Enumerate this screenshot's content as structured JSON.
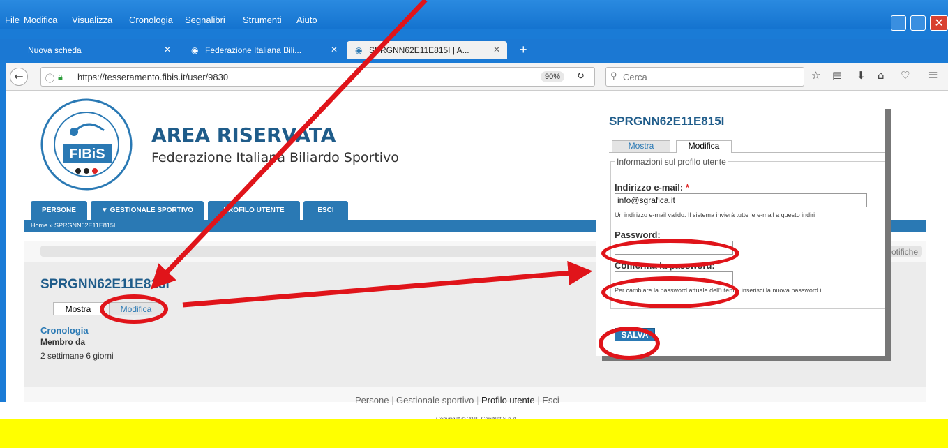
{
  "browser": {
    "menu": [
      "File",
      "Modifica",
      "Visualizza",
      "Cronologia",
      "Segnalibri",
      "Strumenti",
      "Aiuto"
    ],
    "tabs": [
      {
        "label": "Nuova scheda"
      },
      {
        "label": "Federazione Italiana Bili..."
      },
      {
        "label": "SPRGNN62E11E815I | A..."
      }
    ],
    "url": "https://tesseramento.fibis.it/user/9830",
    "zoom": "90%",
    "search_placeholder": "Cerca"
  },
  "site": {
    "title": "AREA RISERVATA",
    "subtitle": "Federazione Italiana Biliardo Sportivo",
    "logo_text": "FIBiS",
    "nav": [
      "PERSONE",
      "▼ GESTIONALE SPORTIVO",
      "PROFILO UTENTE",
      "ESCI"
    ],
    "breadcrumb": "Home » SPRGNN62E11E815I",
    "notifiche_partial": "otifiche"
  },
  "profile": {
    "name": "SPRGNN62E11E815I",
    "tab_show": "Mostra",
    "tab_edit": "Modifica",
    "section": "Cronologia",
    "member_label": "Membro da",
    "member_value": "2 settimane 6 giorni"
  },
  "zoomed": {
    "name": "SPRGNN62E11E815I",
    "tab_show": "Mostra",
    "tab_edit": "Modifica",
    "legend": "Informazioni sul profilo utente",
    "email_label": "Indirizzo e-mail:",
    "required": "*",
    "email_value": "info@sgrafica.it",
    "email_help": "Un indirizzo e-mail valido. Il sistema invierà tutte le e-mail a questo indiri",
    "password_label": "Password:",
    "confirm_label": "Conferma la password:",
    "password_help": "Per cambiare la password attuale dell'utente, inserisci la nuova password i",
    "save": "SALVA"
  },
  "footer": {
    "links": [
      "Persone",
      "Gestionale sportivo",
      "Profilo utente",
      "Esci"
    ],
    "copyright": "Copyright © 2019 ConiNet S.p.A."
  },
  "colors": {
    "annotation": "#e0141a",
    "site_blue": "#2a79b4",
    "title_blue": "#1f5c8a",
    "highlight": "#ffff00"
  }
}
